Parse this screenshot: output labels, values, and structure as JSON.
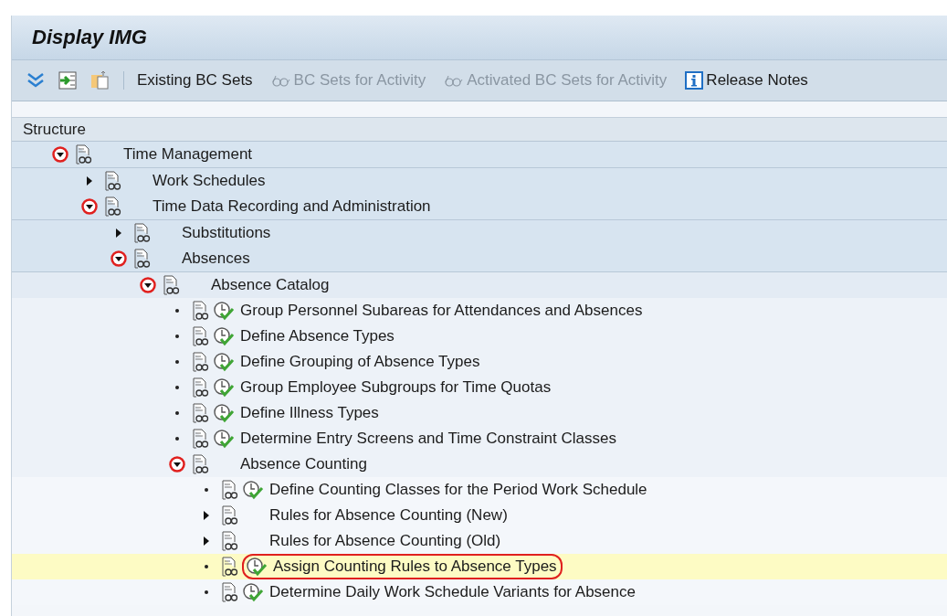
{
  "window": {
    "title": "Display IMG"
  },
  "toolbar": {
    "buttons": [
      {
        "label": "Existing BC Sets",
        "kind": "plain",
        "disabled": false
      },
      {
        "label": "BC Sets for Activity",
        "kind": "glasses",
        "disabled": true
      },
      {
        "label": "Activated BC Sets for Activity",
        "kind": "glasses",
        "disabled": true
      },
      {
        "label": "Release Notes",
        "kind": "info",
        "disabled": false
      }
    ]
  },
  "structure": {
    "header": "Structure",
    "tree": [
      {
        "label": "Time Management",
        "kind": "folder",
        "expanded": true,
        "selected": false,
        "children": [
          {
            "label": "Work Schedules",
            "kind": "folder",
            "expanded": false,
            "selected": false
          },
          {
            "label": "Time Data Recording and Administration",
            "kind": "folder",
            "expanded": true,
            "selected": false,
            "children": [
              {
                "label": "Substitutions",
                "kind": "folder",
                "expanded": false,
                "selected": false
              },
              {
                "label": "Absences",
                "kind": "folder",
                "expanded": true,
                "selected": false,
                "children": [
                  {
                    "label": "Absence Catalog",
                    "kind": "folder",
                    "expanded": true,
                    "selected": false,
                    "children": [
                      {
                        "label": "Group Personnel Subareas for Attendances and Absences",
                        "kind": "activity",
                        "selected": false
                      },
                      {
                        "label": "Define Absence Types",
                        "kind": "activity",
                        "selected": false
                      },
                      {
                        "label": "Define Grouping of Absence Types",
                        "kind": "activity",
                        "selected": false
                      },
                      {
                        "label": "Group Employee Subgroups for Time Quotas",
                        "kind": "activity",
                        "selected": false
                      },
                      {
                        "label": "Define Illness Types",
                        "kind": "activity",
                        "selected": false
                      },
                      {
                        "label": "Determine Entry Screens and Time Constraint Classes",
                        "kind": "activity",
                        "selected": false
                      },
                      {
                        "label": "Absence Counting",
                        "kind": "folder",
                        "expanded": true,
                        "selected": false,
                        "children": [
                          {
                            "label": "Define Counting Classes for the Period Work Schedule",
                            "kind": "activity",
                            "selected": false
                          },
                          {
                            "label": "Rules for Absence Counting (New)",
                            "kind": "folder",
                            "expanded": false,
                            "selected": false
                          },
                          {
                            "label": "Rules for Absence Counting (Old)",
                            "kind": "folder",
                            "expanded": false,
                            "selected": false
                          },
                          {
                            "label": "Assign Counting Rules to Absence Types",
                            "kind": "activity",
                            "selected": true
                          },
                          {
                            "label": "Determine Daily Work Schedule Variants for Absence",
                            "kind": "activity",
                            "selected": false
                          }
                        ]
                      }
                    ]
                  }
                ]
              }
            ]
          }
        ]
      }
    ]
  }
}
